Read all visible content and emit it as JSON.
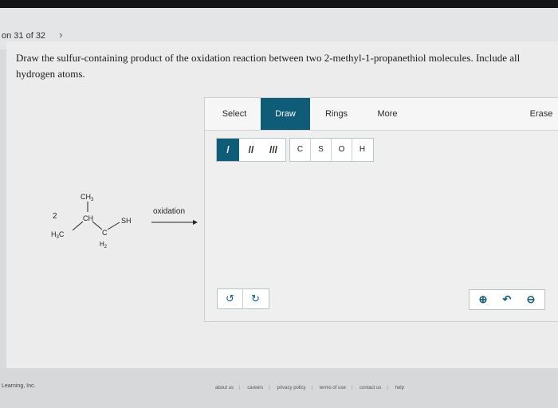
{
  "nav": {
    "question_counter": "on 31 of 32",
    "next_icon": "chevron-right-icon"
  },
  "question": {
    "text": "Draw the sulfur-containing product of the oxidation reaction between two 2-methyl-1-propanethiol molecules. Include all hydrogen atoms."
  },
  "editor": {
    "tabs": {
      "select": "Select",
      "draw": "Draw",
      "rings": "Rings",
      "more": "More",
      "erase": "Erase"
    },
    "bonds": {
      "single": "/",
      "double": "//",
      "triple": "///"
    },
    "atoms": {
      "c": "C",
      "s": "S",
      "o": "O",
      "h": "H"
    },
    "undo_icon": "undo-icon",
    "redo_icon": "redo-icon",
    "zoom_in_icon": "zoom-in-icon",
    "reset_icon": "reset-view-icon",
    "zoom_out_icon": "zoom-out-icon",
    "accent": "#0f5c78"
  },
  "reaction": {
    "coefficient": "2",
    "labels": {
      "ch3": "CH3",
      "ch": "CH",
      "sh": "SH",
      "h3c": "H3C",
      "c": "C",
      "h2": "H2"
    },
    "arrow_label": "oxidation"
  },
  "footer": {
    "brand": "Learning, Inc.",
    "links": [
      "about us",
      "careers",
      "privacy policy",
      "terms of use",
      "contact us",
      "help"
    ]
  }
}
